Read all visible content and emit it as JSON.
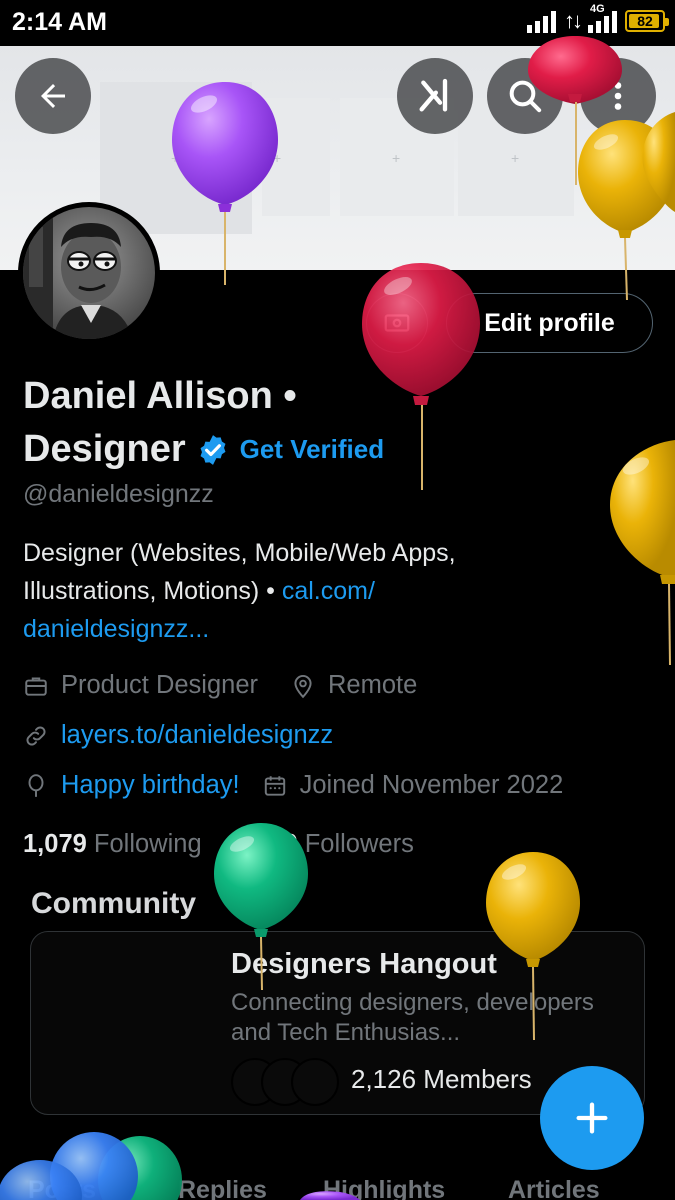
{
  "status_bar": {
    "time": "2:14 AM",
    "network": "4G",
    "battery_level": "82"
  },
  "profile": {
    "name_line1": "Daniel Allison •",
    "name_line2": "Designer",
    "get_verified": "Get Verified",
    "handle": "@danieldesignzz",
    "bio_text": "Designer (Websites, Mobile/Web Apps, Illustrations, Motions) • ",
    "bio_link": "cal.com/ danieldesignzz...",
    "job": "Product Designer",
    "location": "Remote",
    "website": "layers.to/danieldesignzz",
    "birthday": "Happy birthday!",
    "joined": "Joined November 2022",
    "following_count": "1,079",
    "following_label": "Following",
    "followers_count": "1,609",
    "followers_label": "Followers",
    "edit_profile": "Edit profile"
  },
  "community": {
    "title": "Community",
    "name": "Designers Hangout",
    "description": "Connecting designers, developers and Tech Enthusias...",
    "members": "2,126 Members"
  },
  "tabs": [
    "Posts",
    "Replies",
    "Highlights",
    "Articles"
  ],
  "icons": {
    "back": "back-arrow-icon",
    "grok": "grok-icon",
    "search": "search-icon",
    "more": "more-vertical-icon",
    "verified": "verified-badge-icon",
    "job": "briefcase-icon",
    "location": "location-pin-icon",
    "website": "link-icon",
    "birthday": "balloon-icon",
    "joined": "calendar-icon",
    "compose": "plus-icon"
  },
  "colors": {
    "accent": "#1d9bf0",
    "balloon_purple": "#a855f7",
    "balloon_pink": "#e11d48",
    "balloon_yellow": "#eab308",
    "balloon_green": "#10b981",
    "balloon_blue": "#3b82f6"
  }
}
